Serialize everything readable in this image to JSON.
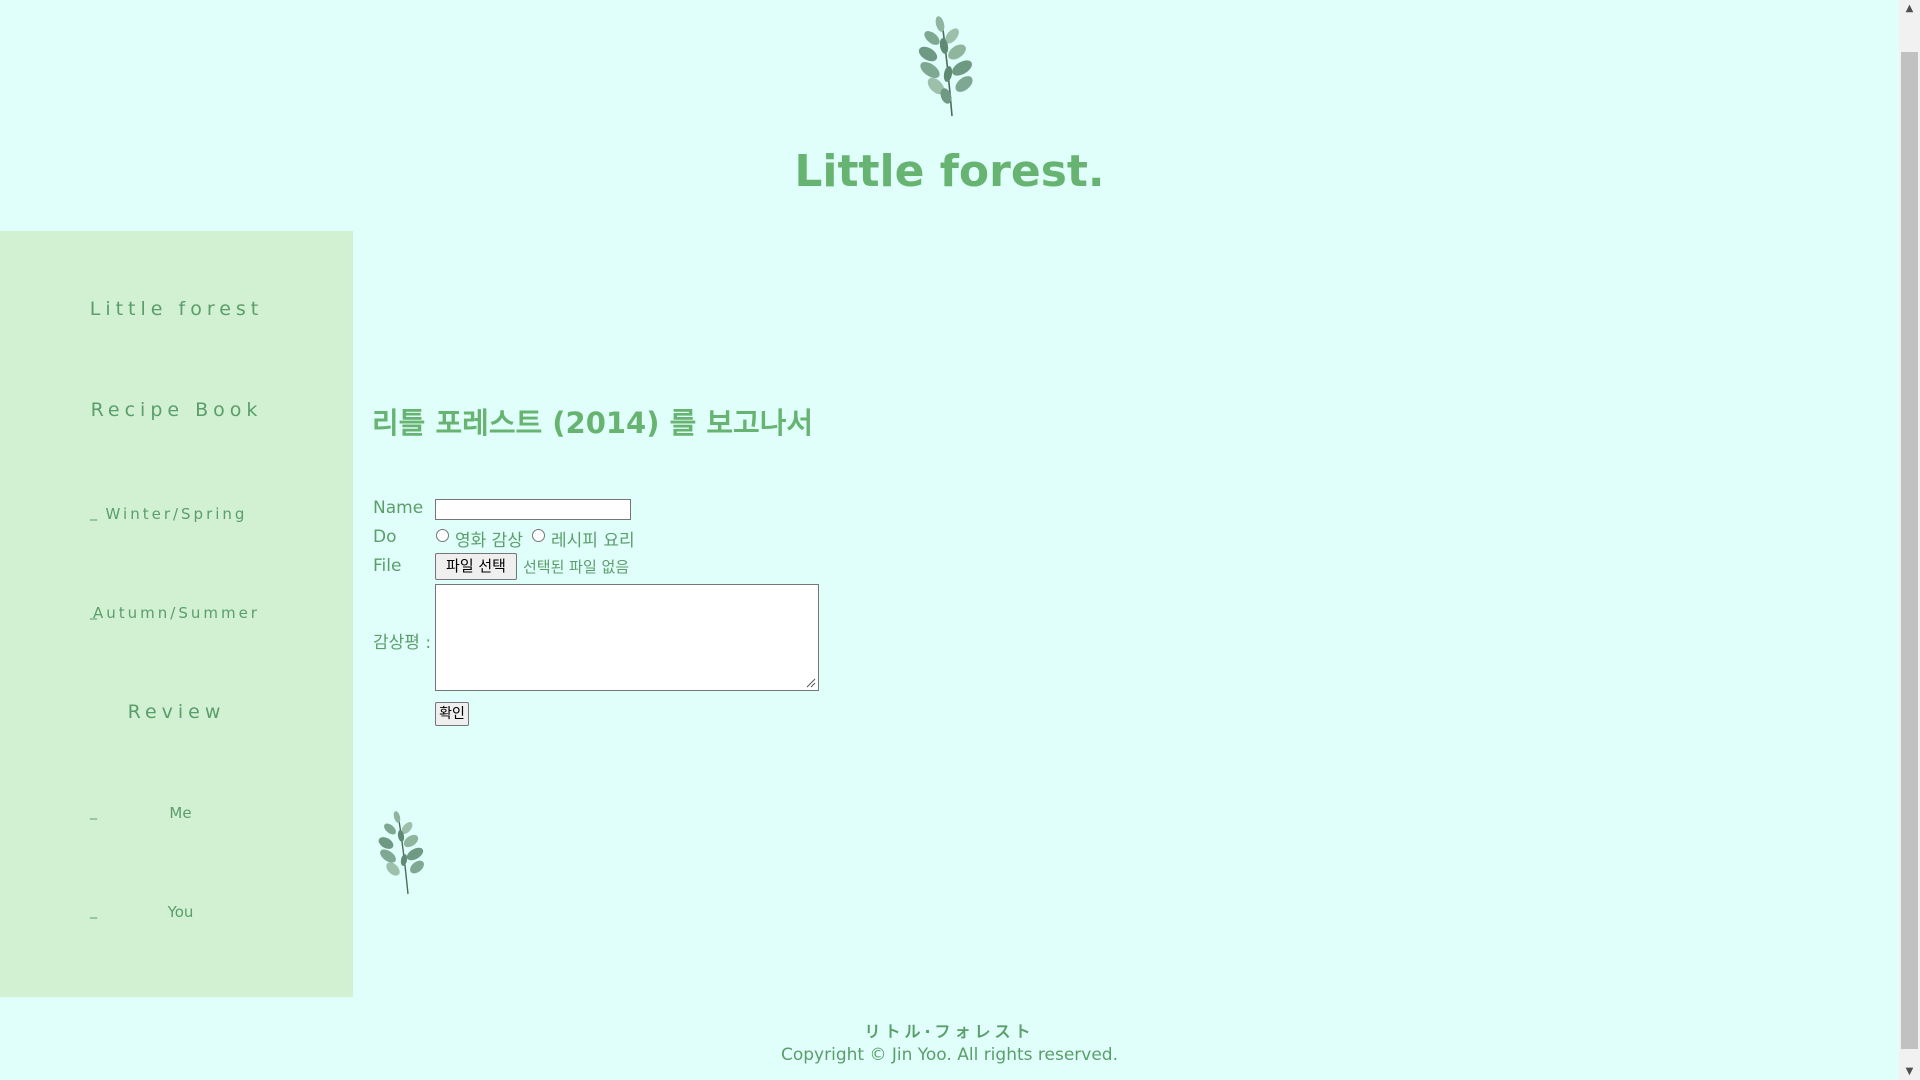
{
  "header": {
    "logo_icon": "eucalyptus-leaf-icon",
    "title": "Little forest."
  },
  "sidebar": {
    "items": [
      {
        "label": "Little forest",
        "kind": "main"
      },
      {
        "label": "Recipe Book",
        "kind": "main"
      },
      {
        "dash": "_",
        "label": "Winter/Spring",
        "kind": "sub"
      },
      {
        "dash": "_",
        "label": "Autumn/Summer",
        "kind": "sub"
      },
      {
        "label": "Review",
        "kind": "main"
      },
      {
        "dash": "_",
        "label": "Me",
        "kind": "sub"
      },
      {
        "dash": "_",
        "label": "You",
        "kind": "sub"
      }
    ]
  },
  "main": {
    "title": "리틀 포레스트 (2014) 를 보고나서",
    "form": {
      "name_label": "Name",
      "name_value": "",
      "do_label": "Do",
      "radio_options": [
        "영화 감상",
        "레시피 요리"
      ],
      "file_label": "File",
      "file_button": "파일 선택",
      "file_status": "선택된 파일 없음",
      "review_label": "감상평 :",
      "review_value": "",
      "submit_label": "확인"
    },
    "bottom_icon": "eucalyptus-leaf-icon"
  },
  "footer": {
    "title": "リトル·フォレスト",
    "copyright": "Copyright © Jin Yoo. All rights reserved."
  },
  "colors": {
    "background": "#e0fffb",
    "sidebar": "#d2f0d2",
    "accent": "#67b371",
    "text": "#5a9e6a"
  }
}
